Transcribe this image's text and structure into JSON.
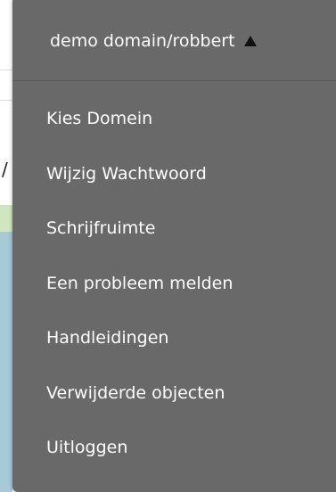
{
  "background": {
    "cut_text": "/"
  },
  "dropdown": {
    "header_label": "demo domain/robbert",
    "caret_icon": "caret-up-icon",
    "bg_color": "#696969",
    "text_color": "#ffffff",
    "items": [
      {
        "label": "Kies Domein"
      },
      {
        "label": "Wijzig Wachtwoord"
      },
      {
        "label": "Schrijfruimte"
      },
      {
        "label": "Een probleem melden"
      },
      {
        "label": "Handleidingen"
      },
      {
        "label": "Verwijderde objecten"
      },
      {
        "label": "Uitloggen"
      }
    ]
  }
}
